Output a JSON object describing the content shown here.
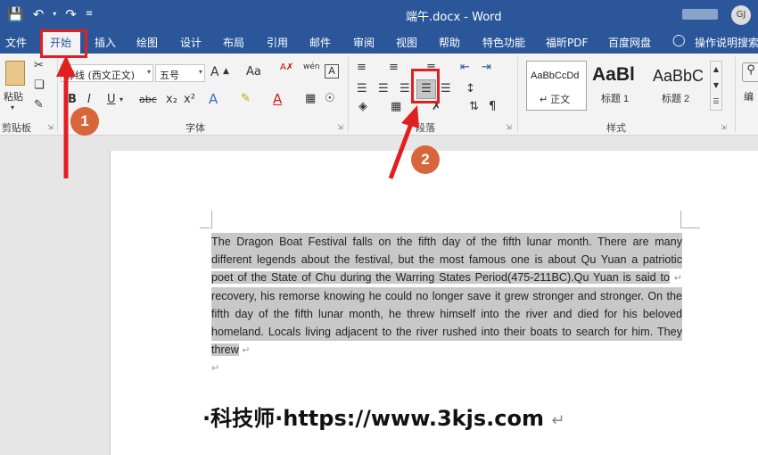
{
  "titlebar": {
    "doc_title": "端午.docx  -  Word",
    "user_initials": "GJ"
  },
  "qat": {
    "save_icon": "save-icon",
    "undo_icon": "undo-icon",
    "redo_icon": "redo-icon",
    "customize_icon": "customize-qat-icon"
  },
  "tabs": [
    {
      "label": "文件"
    },
    {
      "label": "开始"
    },
    {
      "label": "插入"
    },
    {
      "label": "绘图"
    },
    {
      "label": "设计"
    },
    {
      "label": "布局"
    },
    {
      "label": "引用"
    },
    {
      "label": "邮件"
    },
    {
      "label": "审阅"
    },
    {
      "label": "视图"
    },
    {
      "label": "帮助"
    },
    {
      "label": "特色功能"
    },
    {
      "label": "福昕PDF"
    },
    {
      "label": "百度网盘"
    },
    {
      "label": "操作说明搜索"
    }
  ],
  "ribbon": {
    "clipboard": {
      "paste_label": "粘贴",
      "group_label": "剪贴板"
    },
    "font": {
      "font_name": "等线 (西文正文)",
      "font_size": "五号",
      "group_label": "字体",
      "bold": "B",
      "italic": "I",
      "underline": "U",
      "strike": "abc",
      "subscript": "x₂",
      "superscript": "x²",
      "grow": "A",
      "change_case": "Aa",
      "phonetic": "wén",
      "border": "A"
    },
    "paragraph": {
      "group_label": "段落"
    },
    "styles": {
      "group_label": "样式",
      "items": [
        {
          "sample": "AaBbCcDd",
          "name": "↵ 正文"
        },
        {
          "sample": "AaBl",
          "name": "标题 1"
        },
        {
          "sample": "AaBbC",
          "name": "标题 2"
        }
      ]
    },
    "editing": {
      "label": "编"
    }
  },
  "document": {
    "lines": [
      "The Dragon Boat Festival falls on the fifth day of the fifth lunar month. There are many",
      "different legends about the festival, but the most famous one is about Qu Yuan a patriotic",
      "poet of the State of Chu during the Warring States Period(475-211BC).Qu Yuan is said to",
      "recovery, his remorse knowing he could no longer save it grew stronger and stronger. On the",
      "fifth day of the fifth lunar month, he threw himself into the river and died for his beloved",
      "homeland. Locals living adjacent to the river rushed into their boats to search for him. They",
      "threw"
    ],
    "para_mark": "↵",
    "watermark": "·科技师·https://www.3kjs.com"
  },
  "annotations": {
    "badge1": "1",
    "badge2": "2"
  },
  "colors": {
    "accent": "#2b579a",
    "highlight": "#c8c8c8",
    "annotation_red": "#e02020",
    "badge": "#d9653a"
  }
}
